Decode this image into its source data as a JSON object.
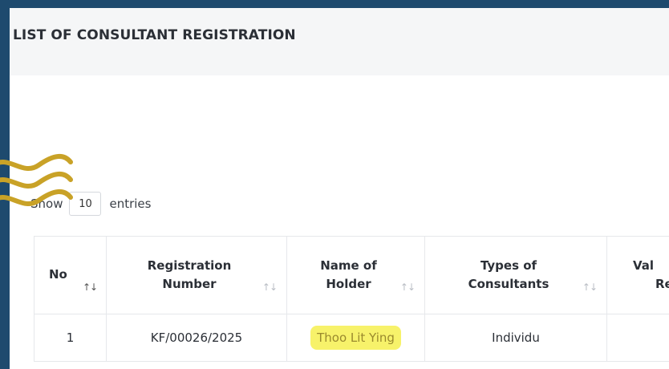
{
  "page": {
    "title": "LIST OF CONSULTANT REGISTRATION"
  },
  "length": {
    "show_label": "Show",
    "value": "10",
    "entries_label": "entries"
  },
  "table": {
    "headers": {
      "no": "No",
      "reg_line1": "Registration",
      "reg_line2": "Number",
      "name_line1": "Name of",
      "name_line2": "Holder",
      "type_line1": "Types of",
      "type_line2": "Consultants",
      "valid_line1": "Val",
      "valid_line2": "Re"
    },
    "rows": [
      {
        "no": "1",
        "registration_number": "KF/00026/2025",
        "name_of_holder": "Thoo Lit Ying",
        "type": "Individu",
        "validity": ""
      }
    ]
  },
  "colors": {
    "frame": "#1e4a6e",
    "highlight": "#f7f26a",
    "squiggle": "#c9a227"
  },
  "icons": {
    "sort": "sort-arrows-icon"
  }
}
